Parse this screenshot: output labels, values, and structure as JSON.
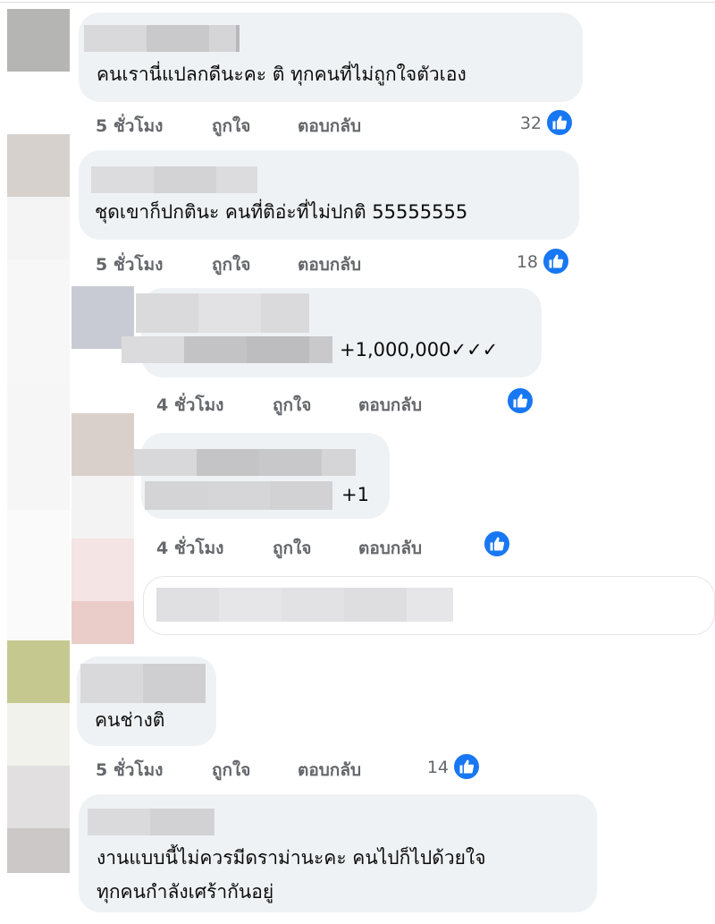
{
  "comments": [
    {
      "text": "คนเรานี่แปลกดีนะคะ ติ ทุกคนที่ไม่ถูกใจตัวเอง",
      "time": "5 ชั่วโมง",
      "like": "ถูกใจ",
      "reply": "ตอบกลับ",
      "likes": "32"
    },
    {
      "text": "ชุดเขาก็ปกตินะ คนที่ติอ่ะที่ไม่ปกติ 55555555",
      "time": "5 ชั่วโมง",
      "like": "ถูกใจ",
      "reply": "ตอบกลับ",
      "likes": "18"
    },
    {
      "text": "+1,000,000✓✓✓",
      "time": "4 ชั่วโมง",
      "like": "ถูกใจ",
      "reply": "ตอบกลับ",
      "likes": ""
    },
    {
      "text": "+1",
      "time": "4 ชั่วโมง",
      "like": "ถูกใจ",
      "reply": "ตอบกลับ",
      "likes": ""
    },
    {
      "text": "คนช่างติ",
      "time": "5 ชั่วโมง",
      "like": "ถูกใจ",
      "reply": "ตอบกลับ",
      "likes": "14"
    },
    {
      "text_line1": "งานแบบนี้ไม่ควรมีดราม่านะคะ คนไปก็ไปด้วยใจ",
      "text_line2": "ทุกคนกำลังเศร้ากันอยู่"
    }
  ],
  "icons": {
    "like": "like-thumb-icon"
  },
  "colors": {
    "like_blue": "#1877f2",
    "bubble": "#eff2f5",
    "meta": "#65676b"
  }
}
